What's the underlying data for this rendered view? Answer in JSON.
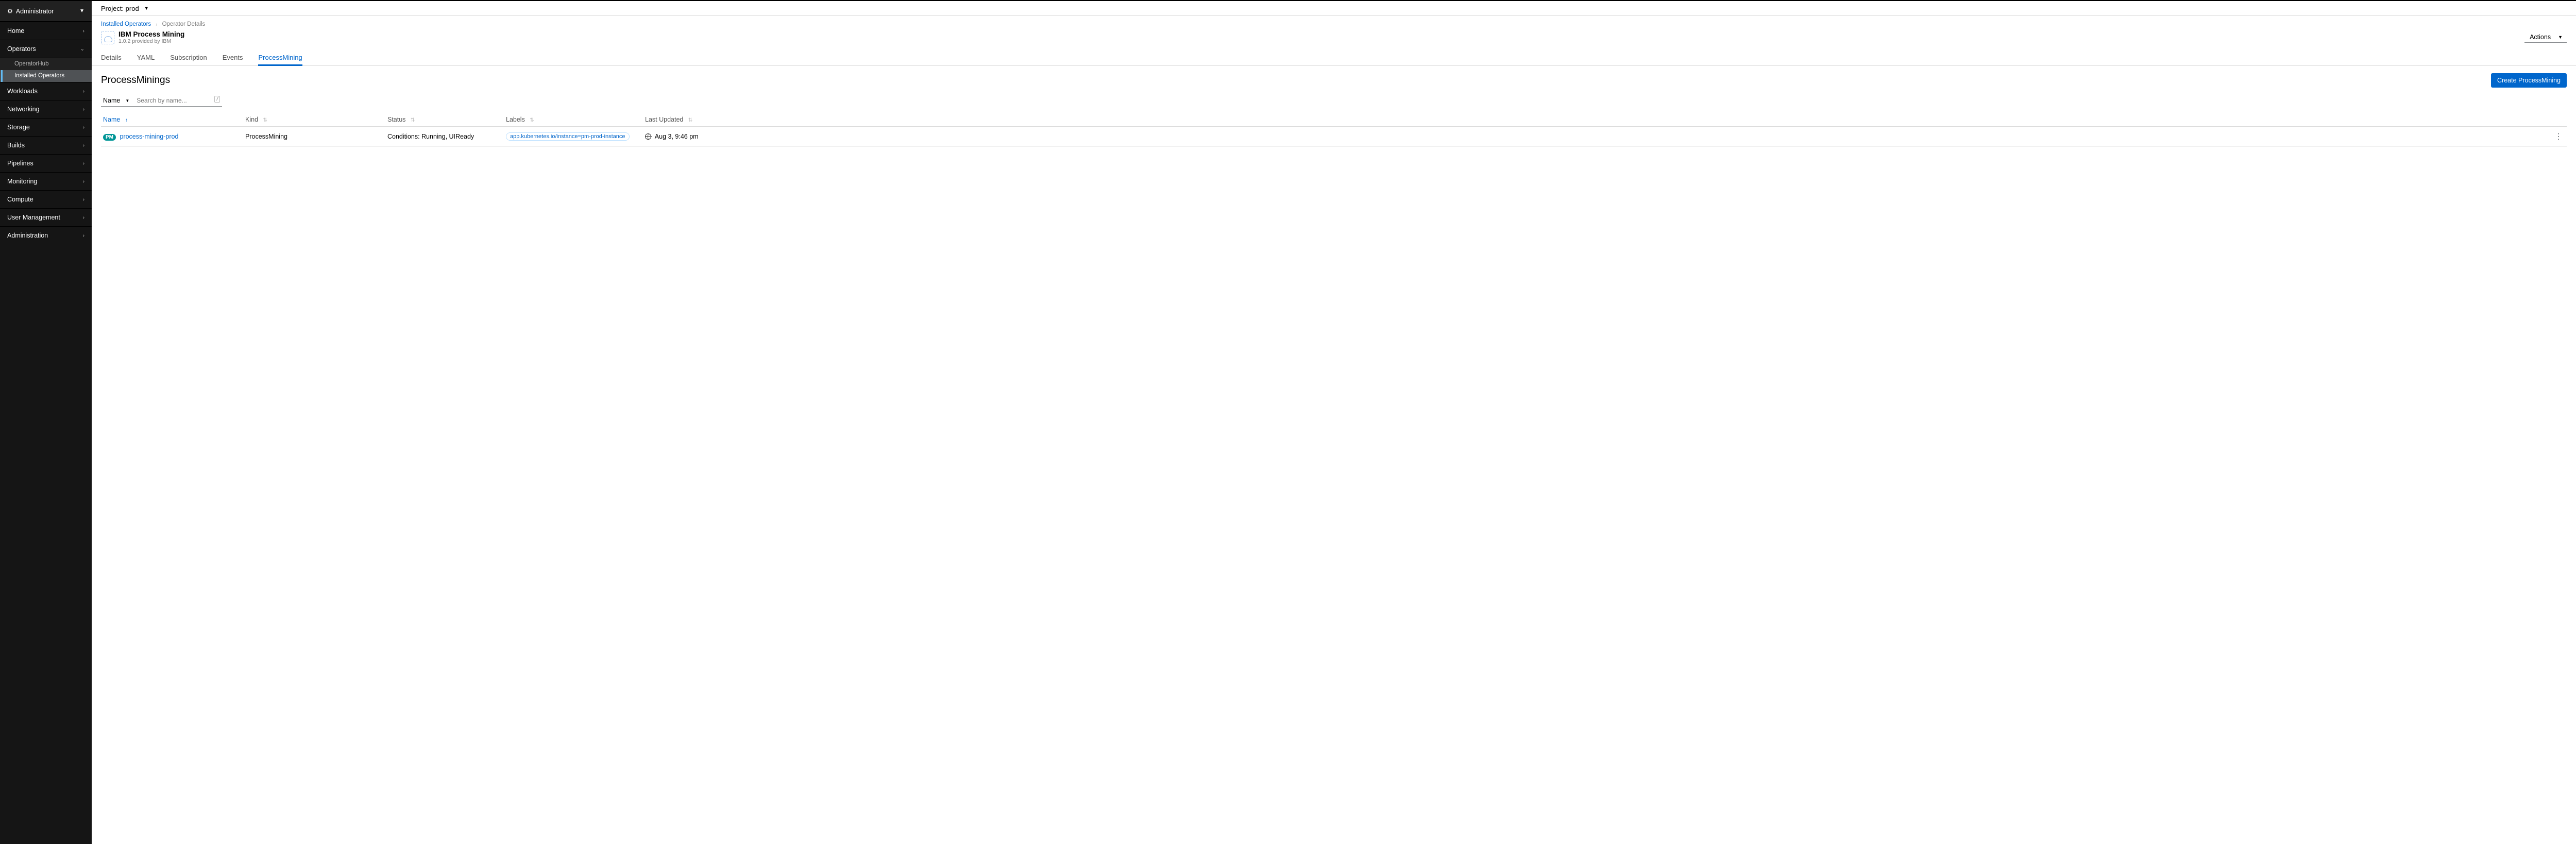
{
  "perspective": "Administrator",
  "nav": {
    "home": "Home",
    "operators": "Operators",
    "op_sub": {
      "hub": "OperatorHub",
      "installed": "Installed Operators"
    },
    "workloads": "Workloads",
    "networking": "Networking",
    "storage": "Storage",
    "builds": "Builds",
    "pipelines": "Pipelines",
    "monitoring": "Monitoring",
    "compute": "Compute",
    "usermgmt": "User Management",
    "admin": "Administration"
  },
  "project_bar": {
    "label": "Project: prod"
  },
  "breadcrumb": {
    "parent": "Installed Operators",
    "current": "Operator Details"
  },
  "operator": {
    "title": "IBM Process Mining",
    "subtitle": "1.0.2 provided by IBM"
  },
  "actions_label": "Actions",
  "tabs": {
    "details": "Details",
    "yaml": "YAML",
    "subscription": "Subscription",
    "events": "Events",
    "processmining": "ProcessMining"
  },
  "page_title": "ProcessMinings",
  "create_button": "Create ProcessMining",
  "filter": {
    "by": "Name",
    "placeholder": "Search by name..."
  },
  "cols": {
    "name": "Name",
    "kind": "Kind",
    "status": "Status",
    "labels": "Labels",
    "updated": "Last Updated"
  },
  "rows": [
    {
      "badge": "PM",
      "name": "process-mining-prod",
      "kind": "ProcessMining",
      "status": "Conditions: Running, UIReady",
      "label": "app.kubernetes.io/instance=pm-prod-instance",
      "updated": "Aug 3, 9:46 pm"
    }
  ]
}
